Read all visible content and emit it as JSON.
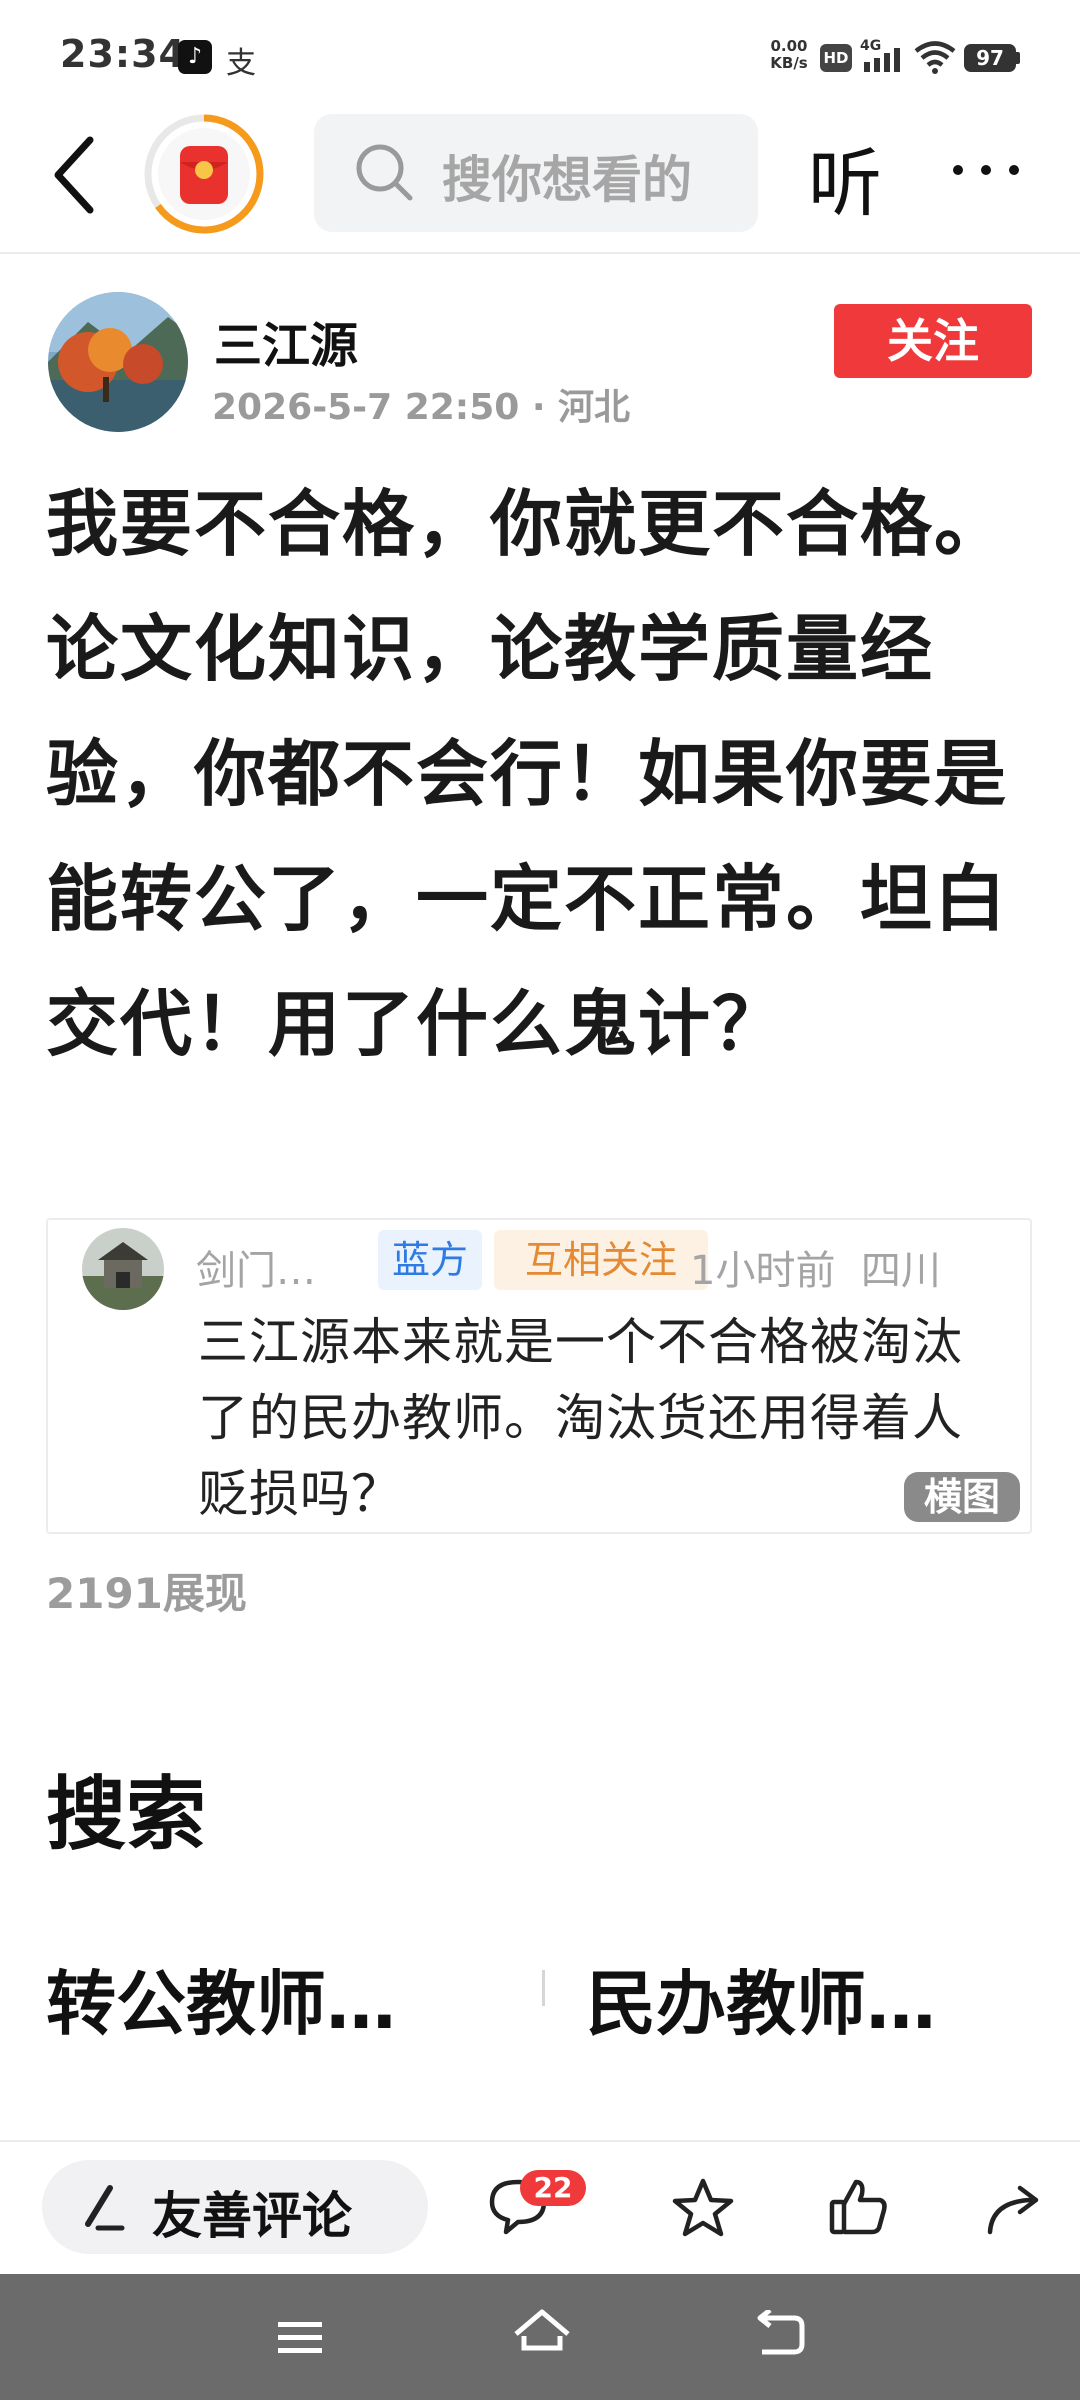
{
  "status_bar": {
    "time": "23:34",
    "net_speed_value": "0.00",
    "net_speed_unit": "KB/s",
    "hd_label": "HD",
    "signal_label": "4G",
    "battery": "97",
    "alipay_glyph": "支"
  },
  "top_nav": {
    "search_placeholder": "搜你想看的",
    "listen_label": "听"
  },
  "post": {
    "author_name": "三江源",
    "meta": "2026-5-7 22:50 · 河北",
    "follow_label": "关注",
    "text": "我要不合格，你就更不合格。论文化知识，论教学质量经验，你都不会行！如果你要是能转公了，一定不正常。坦白交代！用了什么鬼计？",
    "views": "2191展现"
  },
  "quoted_comment": {
    "author": "剑门…",
    "badge_blue": "蓝方",
    "badge_orange": "互相关注",
    "time_location": "1小时前  四川",
    "text": "三江源本来就是一个不合格被淘汰了的民办教师。淘汰货还用得着人贬损吗？",
    "tag": "横图"
  },
  "search_section": {
    "title": "搜索",
    "suggestions": [
      "转公教师…",
      "民办教师…"
    ]
  },
  "action_bar": {
    "comment_label": "友善评论",
    "comment_count": "22"
  },
  "colors": {
    "accent_red": "#f0393a",
    "badge_blue": "#2f7be3",
    "badge_orange": "#e38a32",
    "nav_bar": "#6b6b6b"
  }
}
